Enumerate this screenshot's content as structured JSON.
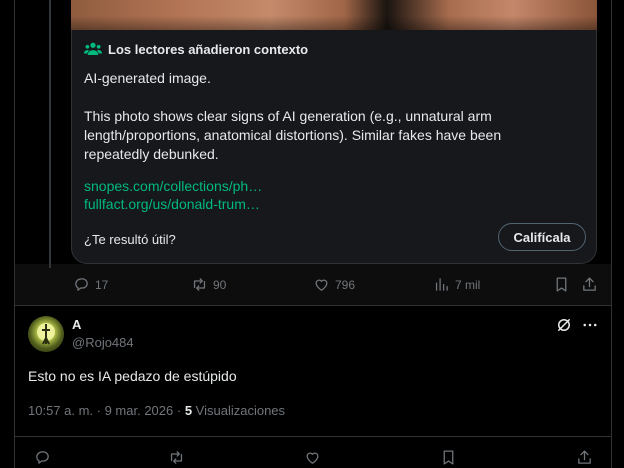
{
  "community_note": {
    "header": "Los lectores añadieron contexto",
    "paragraph1": "AI-generated image.",
    "paragraph2": "This photo shows clear signs of AI generation (e.g., unnatural arm length/proportions, anatomical distortions). Similar fakes have been repeatedly debunked.",
    "links": [
      "snopes.com/collections/ph…",
      "fullfact.org/us/donald-trum…"
    ],
    "question": "¿Te resultó útil?",
    "rate_button": "Califícala"
  },
  "tweet_actions": {
    "replies": "17",
    "reposts": "90",
    "likes": "796",
    "views": "7 mil"
  },
  "reply": {
    "display_name": "A",
    "handle": "@Rojo484",
    "text": "Esto no es IA pedazo de estúpido",
    "timestamp": "10:57 a. m. · 9 mar. 2026 · ",
    "views_count": "5",
    "views_label": " Visualizaciones"
  },
  "colors": {
    "background": "#000000",
    "card": "#16181c",
    "text_primary": "#e7e9ea",
    "text_secondary": "#71767b",
    "link_green": "#00ba7c",
    "border": "#2f3336"
  },
  "icons": [
    "people-icon",
    "reply-icon",
    "repost-icon",
    "like-icon",
    "views-icon",
    "bookmark-icon",
    "share-icon",
    "grok-icon",
    "more-icon"
  ]
}
